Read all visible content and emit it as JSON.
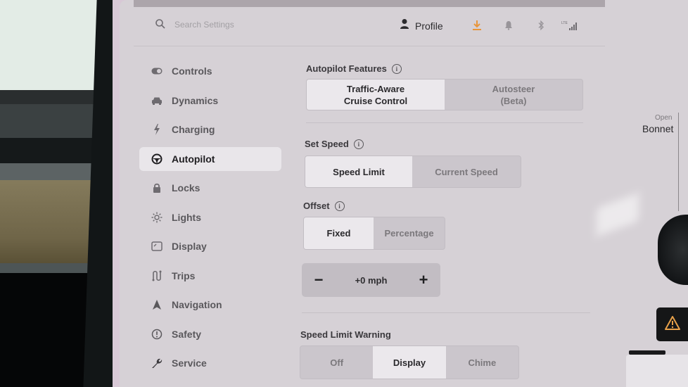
{
  "header": {
    "search_placeholder": "Search Settings",
    "profile_label": "Profile",
    "icons": [
      "download-icon",
      "bell-icon",
      "bluetooth-icon",
      "lte-signal-icon"
    ],
    "lte_label": "LTE",
    "download_color": "#e8953a"
  },
  "sidebar": {
    "items": [
      {
        "label": "Controls",
        "icon": "toggle-icon"
      },
      {
        "label": "Dynamics",
        "icon": "car-icon"
      },
      {
        "label": "Charging",
        "icon": "bolt-icon"
      },
      {
        "label": "Autopilot",
        "icon": "steering-wheel-icon",
        "active": true
      },
      {
        "label": "Locks",
        "icon": "lock-icon"
      },
      {
        "label": "Lights",
        "icon": "sun-icon"
      },
      {
        "label": "Display",
        "icon": "display-icon"
      },
      {
        "label": "Trips",
        "icon": "trips-icon"
      },
      {
        "label": "Navigation",
        "icon": "navigation-arrow-icon"
      },
      {
        "label": "Safety",
        "icon": "alert-circle-icon"
      },
      {
        "label": "Service",
        "icon": "wrench-icon"
      }
    ]
  },
  "autopilot_features": {
    "title": "Autopilot Features",
    "options": [
      "Traffic-Aware\nCruise Control",
      "Autosteer\n(Beta)"
    ],
    "option_line1": [
      "Traffic-Aware",
      "Autosteer"
    ],
    "option_line2": [
      "Cruise Control",
      "(Beta)"
    ],
    "selected": "Traffic-Aware Cruise Control"
  },
  "set_speed": {
    "title": "Set Speed",
    "options": [
      "Speed Limit",
      "Current Speed"
    ],
    "selected": "Speed Limit"
  },
  "offset": {
    "title": "Offset",
    "options": [
      "Fixed",
      "Percentage"
    ],
    "selected": "Fixed",
    "value": "+0 mph",
    "minus": "−",
    "plus": "+"
  },
  "speed_limit_warning": {
    "title": "Speed Limit Warning",
    "options": [
      "Off",
      "Display",
      "Chime"
    ],
    "selected": "Display"
  },
  "right_panel": {
    "open_label": "Open",
    "bonnet_label": "Bonnet",
    "warning_color": "#e8a14a"
  }
}
